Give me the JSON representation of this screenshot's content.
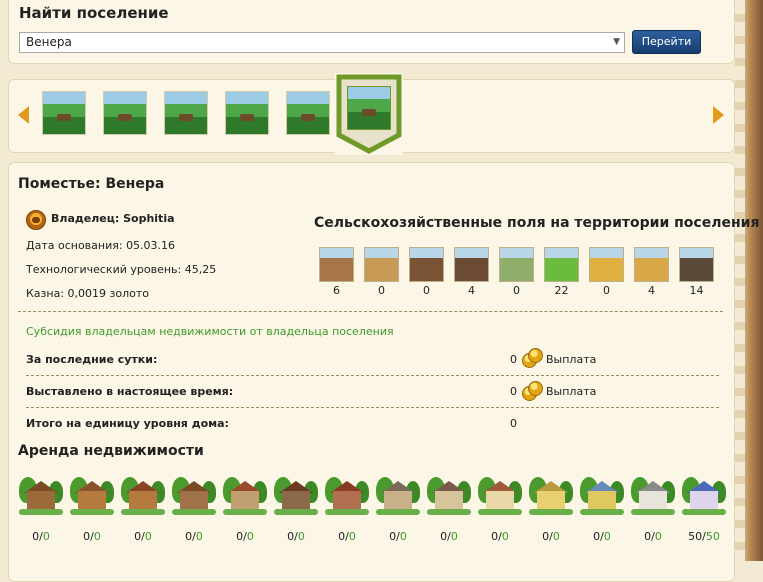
{
  "search": {
    "title": "Найти поселение",
    "selected_value": "Венера",
    "go_label": "Перейти"
  },
  "carousel": {
    "thumbnail_count": 6,
    "active_index": 5
  },
  "estate": {
    "title": "Поместье: Венера",
    "owner_label": "Владелец: Sophitia",
    "founded": "Дата основания: 05.03.16",
    "tech_level": "Технологический уровень: 45,25",
    "treasury": "Казна: 0,0019 золото",
    "fields_title": "Сельскохозяйственные поля на территории поселения",
    "fields": [
      {
        "count": "6",
        "color": "#a8744a"
      },
      {
        "count": "0",
        "color": "#c79a56"
      },
      {
        "count": "0",
        "color": "#7a5234"
      },
      {
        "count": "4",
        "color": "#6b4b34"
      },
      {
        "count": "0",
        "color": "#8fae6a"
      },
      {
        "count": "22",
        "color": "#6abb3e"
      },
      {
        "count": "0",
        "color": "#e0b040"
      },
      {
        "count": "4",
        "color": "#d8a848"
      },
      {
        "count": "14",
        "color": "#5a4a3a"
      }
    ],
    "subsidy_title": "Субсидия владельцам недвижимости от владельца поселения",
    "rows": [
      {
        "label": "За последние сутки:",
        "value": "0",
        "payout": "Выплата"
      },
      {
        "label": "Выставлено в настоящее время:",
        "value": "0",
        "payout": "Выплата"
      },
      {
        "label": "Итого на единицу уровня дома:",
        "value": "0"
      }
    ],
    "rent_title": "Аренда недвижимости",
    "houses": [
      {
        "a": "0",
        "b": "0",
        "wall": "#9a6a3a",
        "roof": "#7a4a26"
      },
      {
        "a": "0",
        "b": "0",
        "wall": "#b57a3e",
        "roof": "#8a5228"
      },
      {
        "a": "0",
        "b": "0",
        "wall": "#b57a3e",
        "roof": "#8a4424"
      },
      {
        "a": "0",
        "b": "0",
        "wall": "#a0724a",
        "roof": "#7a4a26"
      },
      {
        "a": "0",
        "b": "0",
        "wall": "#c0a070",
        "roof": "#9a4a2a"
      },
      {
        "a": "0",
        "b": "0",
        "wall": "#8a6a4a",
        "roof": "#6a3a22"
      },
      {
        "a": "0",
        "b": "0",
        "wall": "#b07050",
        "roof": "#8a3a22"
      },
      {
        "a": "0",
        "b": "0",
        "wall": "#c8b088",
        "roof": "#7a6a5a"
      },
      {
        "a": "0",
        "b": "0",
        "wall": "#d8c49a",
        "roof": "#7a5a48"
      },
      {
        "a": "0",
        "b": "0",
        "wall": "#e8d8a8",
        "roof": "#a05a3a"
      },
      {
        "a": "0",
        "b": "0",
        "wall": "#e8d070",
        "roof": "#b89a40"
      },
      {
        "a": "0",
        "b": "0",
        "wall": "#e0c860",
        "roof": "#6a8ab8"
      },
      {
        "a": "0",
        "b": "0",
        "wall": "#e8e4dc",
        "roof": "#8a8a8a"
      },
      {
        "a": "50",
        "b": "50",
        "wall": "#e0d4ec",
        "roof": "#4a6ab8"
      }
    ]
  },
  "colors": {
    "accent_green": "#3f9a2c",
    "button_blue": "#1f4a85",
    "coin_gold": "#e4a514"
  }
}
